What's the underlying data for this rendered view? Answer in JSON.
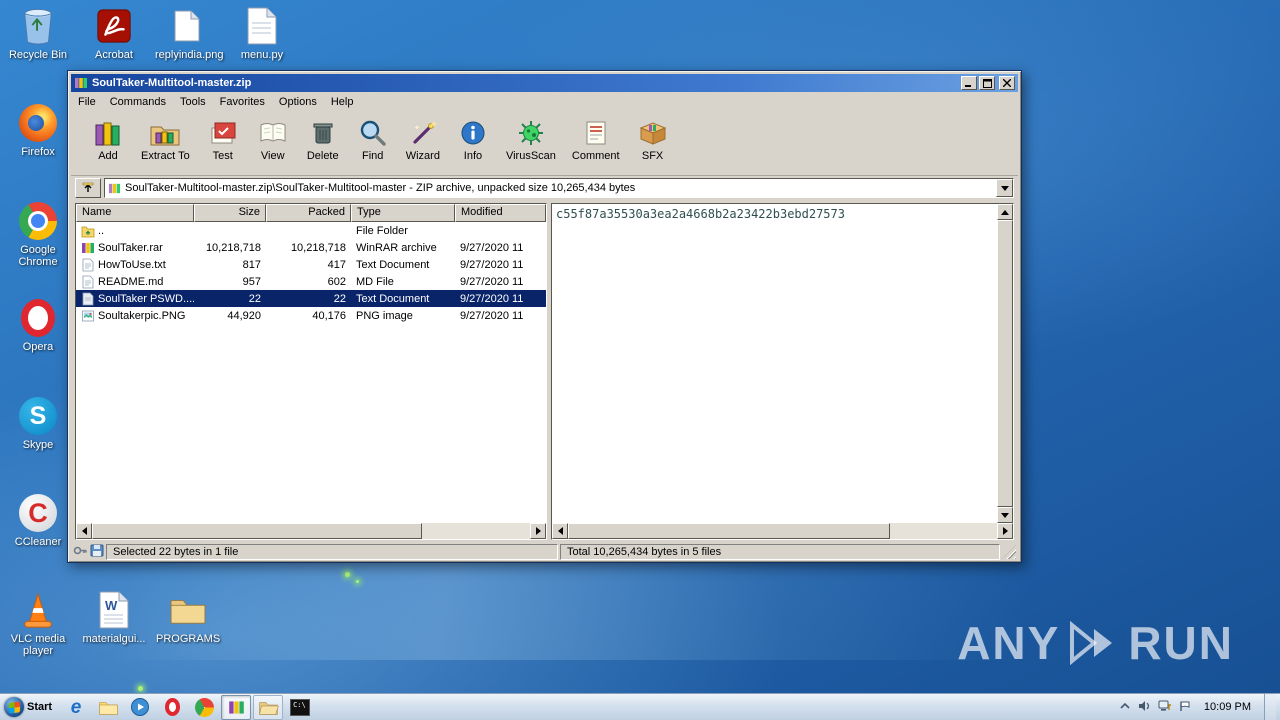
{
  "desktop": {
    "watermark": {
      "left": "ANY",
      "right": "RUN"
    },
    "icons": [
      {
        "label": "Recycle Bin"
      },
      {
        "label": "Firefox"
      },
      {
        "label": "Google Chrome"
      },
      {
        "label": "Opera"
      },
      {
        "label": "Skype"
      },
      {
        "label": "CCleaner"
      },
      {
        "label": "VLC media player"
      },
      {
        "label": "Acrobat"
      },
      {
        "label": "replyindia.png"
      },
      {
        "label": "menu.py"
      },
      {
        "label": "materialgui..."
      },
      {
        "label": "PROGRAMS"
      }
    ]
  },
  "glyphs": {
    "skype": "S",
    "ie": "e",
    "ccleaner": "C",
    "word": "W",
    "cmd": "C:\\"
  },
  "winrar": {
    "title": "SoulTaker-Multitool-master.zip",
    "menu": [
      {
        "label": "File"
      },
      {
        "label": "Commands"
      },
      {
        "label": "Tools"
      },
      {
        "label": "Favorites"
      },
      {
        "label": "Options"
      },
      {
        "label": "Help"
      }
    ],
    "toolbar": [
      {
        "label": "Add"
      },
      {
        "label": "Extract To"
      },
      {
        "label": "Test"
      },
      {
        "label": "View"
      },
      {
        "label": "Delete"
      },
      {
        "label": "Find"
      },
      {
        "label": "Wizard"
      },
      {
        "label": "Info"
      },
      {
        "label": "VirusScan"
      },
      {
        "label": "Comment"
      },
      {
        "label": "SFX"
      }
    ],
    "address": "SoulTaker-Multitool-master.zip\\SoulTaker-Multitool-master - ZIP archive, unpacked size 10,265,434 bytes",
    "columns": [
      {
        "label": "Name"
      },
      {
        "label": "Size"
      },
      {
        "label": "Packed"
      },
      {
        "label": "Type"
      },
      {
        "label": "Modified"
      }
    ],
    "files": [
      {
        "name": "..",
        "size": "",
        "packed": "",
        "type": "File Folder",
        "modified": ""
      },
      {
        "name": "SoulTaker.rar",
        "size": "10,218,718",
        "packed": "10,218,718",
        "type": "WinRAR archive",
        "modified": "9/27/2020 11"
      },
      {
        "name": "HowToUse.txt",
        "size": "817",
        "packed": "417",
        "type": "Text Document",
        "modified": "9/27/2020 11"
      },
      {
        "name": "README.md",
        "size": "957",
        "packed": "602",
        "type": "MD File",
        "modified": "9/27/2020 11"
      },
      {
        "name": "SoulTaker PSWD....",
        "size": "22",
        "packed": "22",
        "type": "Text Document",
        "modified": "9/27/2020 11"
      },
      {
        "name": "Soultakerpic.PNG",
        "size": "44,920",
        "packed": "40,176",
        "type": "PNG image",
        "modified": "9/27/2020 11"
      }
    ],
    "comment": "c55f87a35530a3ea2a4668b2a23422b3ebd27573",
    "status": {
      "selected": "Selected 22 bytes in 1 file",
      "total": "Total 10,265,434 bytes in 5 files"
    }
  },
  "taskbar": {
    "start_label": "Start",
    "clock": "10:09 PM"
  }
}
